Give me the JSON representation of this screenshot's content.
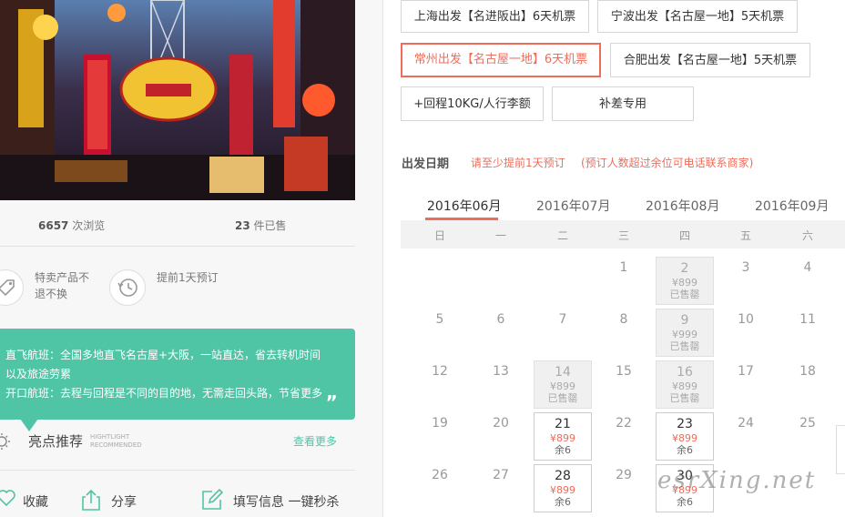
{
  "stats": {
    "views_num": "6657",
    "views_unit": "次浏览",
    "sold_num": "23",
    "sold_unit": "件已售"
  },
  "features": [
    {
      "icon": "tag-icon",
      "label": "特卖产品不退不换"
    },
    {
      "icon": "clock-history-icon",
      "label": "提前1天预订"
    }
  ],
  "flight_notes": {
    "line1": "直飞航班：全国多地直飞名古屋+大阪，一站直达，省去转机时间",
    "line2": "以及旅途劳累",
    "line3": "开口航班：去程与回程是不同的目的地，无需走回头路，节省更多",
    "quote": "„"
  },
  "highlights": {
    "title": "亮点推荐",
    "sub1": "HIGHTLIGHT",
    "sub2": "RECOMMENDED",
    "more": "查看更多"
  },
  "actions": {
    "favorite": "收藏",
    "share": "分享",
    "fill": "填写信息 一键秒杀"
  },
  "options": [
    {
      "label": "上海出发【名进阪出】6天机票",
      "selected": false
    },
    {
      "label": "宁波出发【名古屋一地】5天机票",
      "selected": false
    },
    {
      "label": "常州出发【名古屋一地】6天机票",
      "selected": true
    },
    {
      "label": "合肥出发【名古屋一地】5天机票",
      "selected": false
    },
    {
      "label": "+回程10KG/人行李额",
      "selected": false
    },
    {
      "label": "补差专用",
      "selected": false
    }
  ],
  "date_section": {
    "label": "出发日期",
    "note1": "请至少提前1天预订",
    "note2": "(预订人数超过余位可电话联系商家)"
  },
  "months": [
    "2016年06月",
    "2016年07月",
    "2016年08月",
    "2016年09月"
  ],
  "active_month": "2016年06月",
  "weekdays": [
    "日",
    "一",
    "二",
    "三",
    "四",
    "五",
    "六"
  ],
  "calendar": [
    [
      {
        "d": ""
      },
      {
        "d": ""
      },
      {
        "d": ""
      },
      {
        "d": "1"
      },
      {
        "d": "2",
        "p": "¥899",
        "s": "已售罄",
        "st": "sold"
      },
      {
        "d": "3"
      },
      {
        "d": "4"
      }
    ],
    [
      {
        "d": "5"
      },
      {
        "d": "6"
      },
      {
        "d": "7"
      },
      {
        "d": "8"
      },
      {
        "d": "9",
        "p": "¥999",
        "s": "已售罄",
        "st": "sold"
      },
      {
        "d": "10"
      },
      {
        "d": "11"
      }
    ],
    [
      {
        "d": "12"
      },
      {
        "d": "13"
      },
      {
        "d": "14",
        "p": "¥899",
        "s": "已售罄",
        "st": "sold"
      },
      {
        "d": "15"
      },
      {
        "d": "16",
        "p": "¥899",
        "s": "已售罄",
        "st": "sold"
      },
      {
        "d": "17"
      },
      {
        "d": "18"
      }
    ],
    [
      {
        "d": "19"
      },
      {
        "d": "20"
      },
      {
        "d": "21",
        "p": "¥899",
        "s": "余6",
        "st": "avail"
      },
      {
        "d": "22"
      },
      {
        "d": "23",
        "p": "¥899",
        "s": "余6",
        "st": "avail"
      },
      {
        "d": "24"
      },
      {
        "d": "25"
      }
    ],
    [
      {
        "d": "26"
      },
      {
        "d": "27"
      },
      {
        "d": "28",
        "p": "¥899",
        "s": "余6",
        "st": "avail"
      },
      {
        "d": "29"
      },
      {
        "d": "30",
        "p": "¥899",
        "s": "余6",
        "st": "avail"
      },
      {
        "d": ""
      },
      {
        "d": ""
      }
    ]
  ],
  "watermark": "esrXing.net",
  "colors": {
    "accent": "#f06c5a",
    "green": "#4fc5a5"
  }
}
